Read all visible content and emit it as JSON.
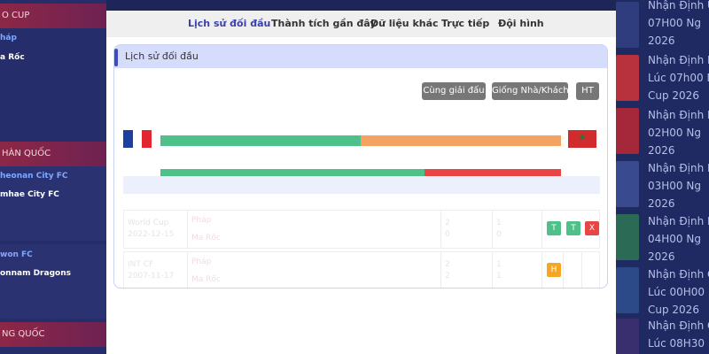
{
  "left_sidebar": {
    "sections": [
      {
        "title": "O CUP",
        "teams": [
          "háp",
          "a Rốc"
        ]
      },
      {
        "title": "HÀN QUỐC",
        "teams": [
          "heonan City FC",
          "mhae City FC"
        ]
      },
      {
        "title": "",
        "teams": [
          "won FC",
          "onnam Dragons"
        ]
      },
      {
        "title": "NG QUỐC",
        "teams": []
      }
    ]
  },
  "tabs": [
    {
      "label": "Lịch sử đối đầu",
      "active": true
    },
    {
      "label": "Thành tích gần đây",
      "active": false
    },
    {
      "label": "Dữ liệu khác",
      "active": false
    },
    {
      "label": "Trực tiếp",
      "active": false
    },
    {
      "label": "Đội hình",
      "active": false
    }
  ],
  "card": {
    "title": "Lịch sử đối đầu",
    "buttons": [
      "Cùng giải đấu",
      "Giống Nhà/Khách",
      "HT"
    ]
  },
  "flags": {
    "home": "france-flag-icon",
    "away": "morocco-flag-icon"
  },
  "stat_bars": [
    {
      "fractions": [
        0.5,
        0.5
      ],
      "colors": [
        "#4ec08a",
        "#f4a261"
      ]
    },
    {
      "fractions": [
        0.66,
        0.34
      ],
      "colors": [
        "#4ec08a",
        "#e84545"
      ]
    }
  ],
  "matches": [
    {
      "competition": "World Cup",
      "date": "2022-12-15",
      "home": "Pháp",
      "away": "Ma Rốc",
      "score_home": "2",
      "score_away": "0",
      "ht_home": "1",
      "ht_away": "0",
      "results": [
        {
          "label": "T",
          "type": "win"
        },
        {
          "label": "T",
          "type": "win"
        },
        {
          "label": "X",
          "type": "lose"
        }
      ]
    },
    {
      "competition": "INT CF",
      "date": "2007-11-17",
      "home": "Pháp",
      "away": "Ma Rốc",
      "score_home": "2",
      "score_away": "2",
      "ht_home": "1",
      "ht_away": "1",
      "results": [
        {
          "label": "H",
          "type": "draw"
        }
      ]
    }
  ],
  "right_sidebar": {
    "items": [
      {
        "lines": [
          "Nhận Định U",
          "07H00 Ng",
          "2026"
        ]
      },
      {
        "lines": [
          "Nhận Định M",
          "Lúc 07h00 N",
          "Cup 2026"
        ]
      },
      {
        "lines": [
          "Nhận Định Pu",
          "02H00 Ng",
          "2026"
        ]
      },
      {
        "lines": [
          "Nhận Định Br",
          "03H00 Ng",
          "2026"
        ]
      },
      {
        "lines": [
          "Nhận Định Pu",
          "04H00 Ng",
          "2026"
        ]
      },
      {
        "lines": [
          "Nhận Định Co",
          "Lúc 00H00 N",
          "Cup 2026"
        ]
      },
      {
        "lines": [
          "Nhận Định Co",
          "Lúc 08H30 N"
        ]
      }
    ]
  },
  "colors": {
    "accent": "#3b3faa",
    "win": "#4ec08a",
    "lose": "#e84545",
    "draw": "#f5a623",
    "button": "#777777"
  }
}
